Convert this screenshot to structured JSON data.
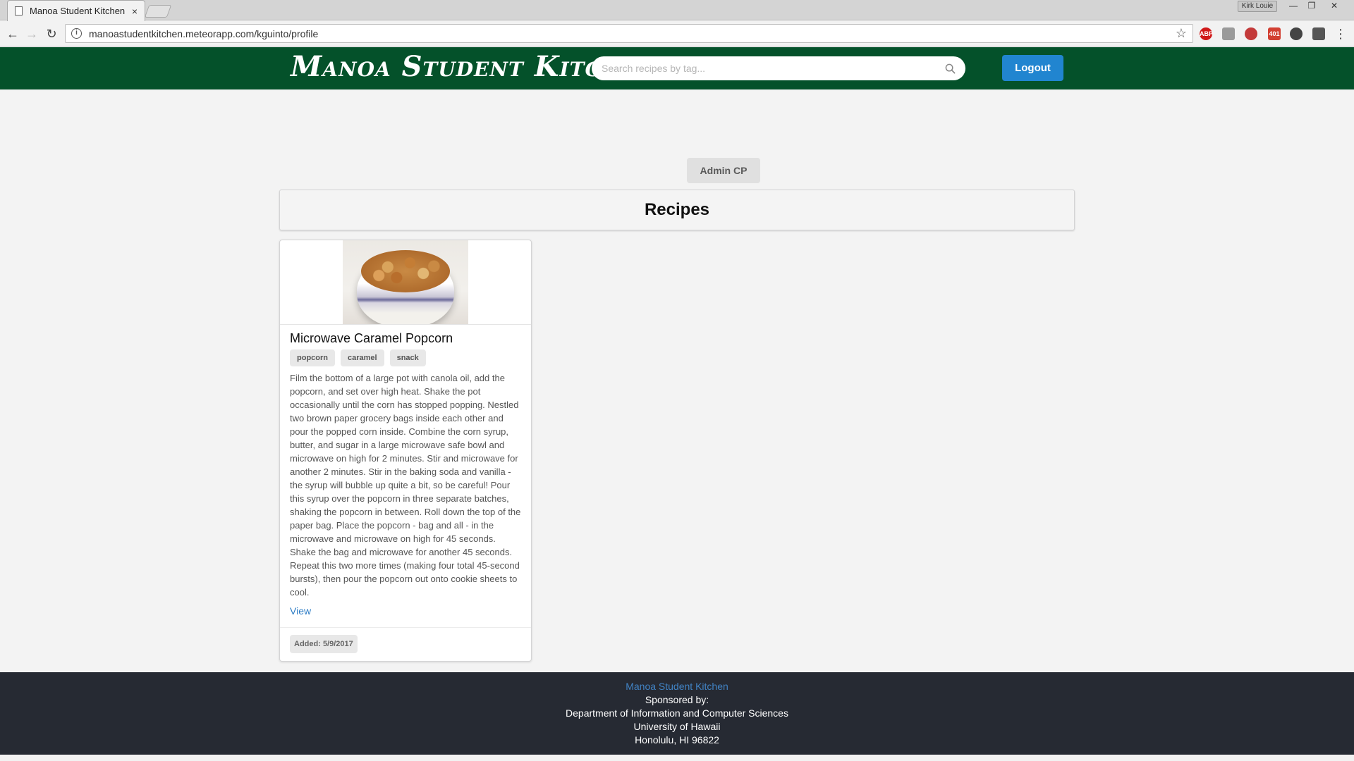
{
  "browser": {
    "tab_title": "Manoa Student Kitchen",
    "tab_close": "×",
    "url": "manoastudentkitchen.meteorapp.com/kguinto/profile",
    "profile_name": "Kirk Louie",
    "extensions": [
      {
        "name": "adblock-plus",
        "label": "ABP",
        "color": "#d01919"
      },
      {
        "name": "extension-2",
        "label": "",
        "color": "#9a9a9a"
      },
      {
        "name": "extension-3",
        "label": "",
        "color": "#c33a3a"
      },
      {
        "name": "gmail-notifier",
        "label": "401",
        "color": "#d23f31"
      },
      {
        "name": "extension-5",
        "label": "",
        "color": "#444444"
      },
      {
        "name": "extension-6",
        "label": "",
        "color": "#555555"
      }
    ]
  },
  "header": {
    "brand": "Manoa Student Kitchen",
    "search_placeholder": "Search recipes by tag...",
    "logout_label": "Logout",
    "bg_color": "#04512a",
    "accent_color": "#2185d0"
  },
  "main": {
    "admin_button": "Admin CP",
    "section_title": "Recipes",
    "recipes": [
      {
        "title": "Microwave Caramel Popcorn",
        "tags": [
          "popcorn",
          "caramel",
          "snack"
        ],
        "description": "Film the bottom of a large pot with canola oil, add the popcorn, and set over high heat. Shake the pot occasionally until the corn has stopped popping. Nestled two brown paper grocery bags inside each other and pour the popped corn inside. Combine the corn syrup, butter, and sugar in a large microwave safe bowl and microwave on high for 2 minutes. Stir and microwave for another 2 minutes. Stir in the baking soda and vanilla - the syrup will bubble up quite a bit, so be careful! Pour this syrup over the popcorn in three separate batches, shaking the popcorn in between. Roll down the top of the paper bag. Place the popcorn - bag and all - in the microwave and microwave on high for 45 seconds. Shake the bag and microwave for another 45 seconds. Repeat this two more times (making four total 45-second bursts), then pour the popcorn out onto cookie sheets to cool.",
        "view_label": "View",
        "added": "Added: 5/9/2017"
      }
    ]
  },
  "footer": {
    "site_link": "Manoa Student Kitchen",
    "sponsored": "Sponsored by:",
    "department": "Department of Information and Computer Sciences",
    "university": "University of Hawaii",
    "address": "Honolulu, HI 96822"
  }
}
